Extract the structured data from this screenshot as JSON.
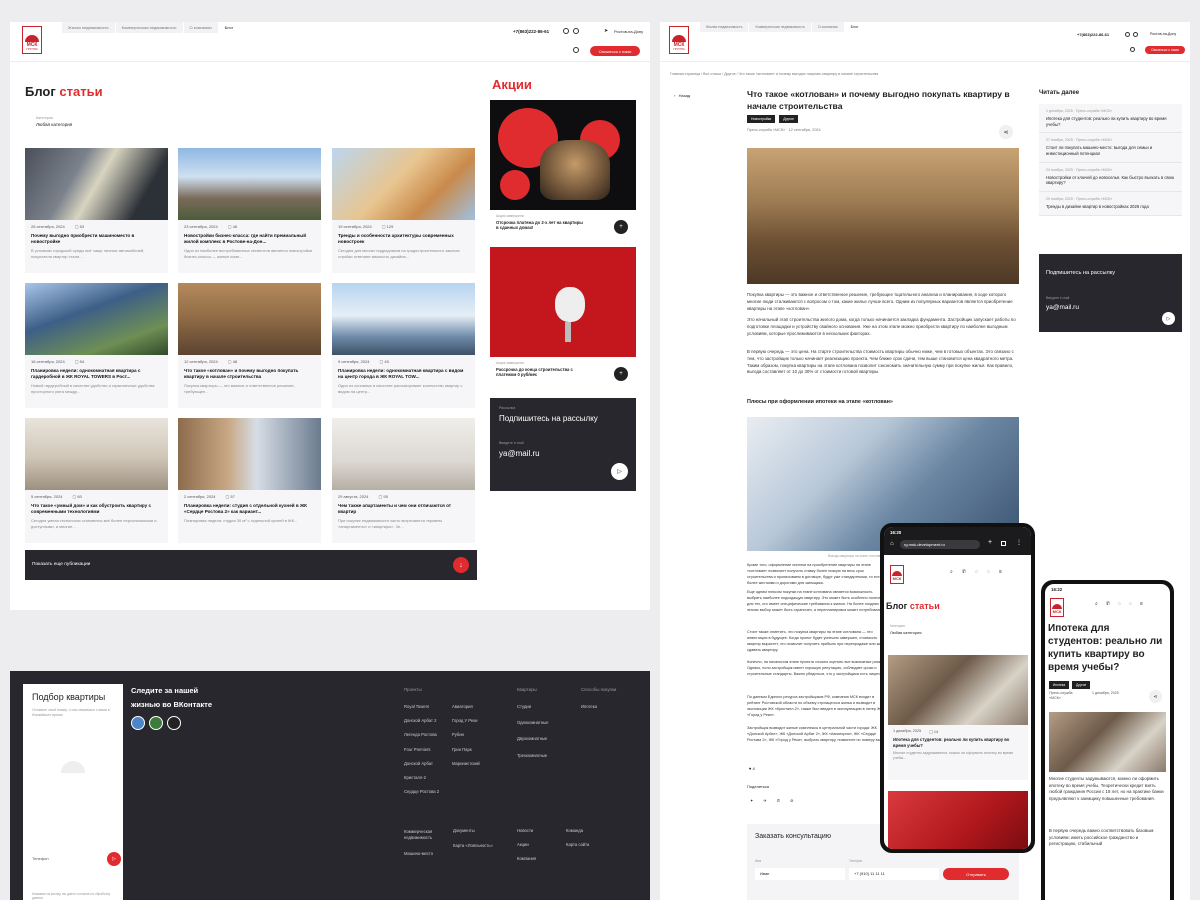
{
  "colors": {
    "accent": "#e02b2f",
    "dark": "#27272d",
    "bg": "#ededf0"
  },
  "logo": {
    "text": "МСК",
    "sub": "ГРУППА"
  },
  "header1": {
    "tabs": [
      "Жилая недвижимость",
      "Коммерческая недвижимость",
      "О компании",
      "Блог"
    ],
    "phone": "+7(863)222-86-61",
    "city": "Ростов-на-Дону",
    "cta": "Связаться с нами"
  },
  "blog": {
    "title_black": "Блог",
    "title_red": "статьи",
    "category_label": "Категория",
    "category_value": "Любая категория",
    "show_more": "Показать еще публикации",
    "cards": [
      {
        "date": "26 сентября, 2024",
        "count": "53",
        "title": "Почему выгодно приобрести машиноместо в новостройке",
        "desc": "В условиях городской среды всё чаще личные автомобилей, покупатели квартир стали..."
      },
      {
        "date": "23 сентября, 2024",
        "count": "46",
        "title": "Новостройки бизнес-класса: где найти премиальный жилой комплекс в Ростове-на-Дон...",
        "desc": "Один из наиболее востребованных сегментов является новостройки бизнес-класса — жилые комп..."
      },
      {
        "date": "19 сентября, 2024",
        "count": "129",
        "title": "Тренды и особенности архитектуры современных новостроек",
        "desc": "Сегодня для многих подрядчиков на градостроительного законах стройки отвечают важность дизайна..."
      },
      {
        "date": "16 сентября, 2024",
        "count": "54",
        "title": "Планировка недели: однокомнатная квартира с гардеробной в ЖК ROYAL TOWERS в Рост...",
        "desc": "Новый гардеробный в качестве удобство и гармоничные удобства просторного уюта между..."
      },
      {
        "date": "12 сентября, 2024",
        "count": "48",
        "title": "Что такое «котлован» и почему выгодно покупать квартиру в начале строительства",
        "desc": "Покупка квартиры — это важное и ответственное решение, требующее..."
      },
      {
        "date": "9 сентября, 2024",
        "count": "45",
        "title": "Планировка недели: однокомнатная квартира с видом на центр города в ЖК ROYAL TOW...",
        "desc": "Один из основных в качестве рассматривает количество квартир с видом на центр..."
      },
      {
        "date": "5 сентября, 2024",
        "count": "60",
        "title": "Что такое «умный дом» и как обустроить квартиру с современными технологиями",
        "desc": "Сегодня умная технология становится всё более персональными и доступными, и многие..."
      },
      {
        "date": "2 сентября, 2024",
        "count": "57",
        "title": "Планировка недели: студия с отдельной кухней в ЖК «Сердце Ростова 2» как вариант...",
        "desc": "Планировка недели: студия 30 м² с отдельной кухней в ЖК..."
      },
      {
        "date": "29 августа, 2024",
        "count": "95",
        "title": "Чем также апартаменты и чем они отличаются от квартир",
        "desc": "При покупке недвижимости часто встречаются термины «апартаменты» и «квартиры». Зн..."
      }
    ]
  },
  "promo": {
    "title": "Акции",
    "items": [
      {
        "label": "Акция завершена",
        "text": "Отсрочка платежа до 2-х лет на квартиры в сданных домах!"
      },
      {
        "label": "Акция завершена",
        "text": "Рассрочка до конца строительства с платежом 0 руб/мес"
      }
    ],
    "subscribe_label": "Рассылка",
    "subscribe_title": "Подпишитесь на рассылку",
    "email_label": "Введите e-mail",
    "email_value": "ya@mail.ru"
  },
  "footer": {
    "form_title": "Подбор квартиры",
    "form_desc": "Оставьте свой номер, и мы свяжемся с вами в ближайшее время",
    "phone_label": "Телефон",
    "vk_text": "Следите за нашей жизнью во ВКонтакте",
    "col1_head": "Проекты",
    "col1a": [
      "Royal Towers",
      "Донской Арбат 2",
      "Легенда Ростова",
      "Four Premiers",
      "Донской Арбат",
      "Кристалл-2",
      "Сердце Ростова 2"
    ],
    "col1b": [
      "Авиатория",
      "Город У Реки",
      "Рубин",
      "Грин Парк",
      "Маринистский"
    ],
    "col2_head": "Квартиры",
    "col2": [
      "Студии",
      "Однокомнатные",
      "Двухкомнатные",
      "Трехкомнатные"
    ],
    "col3_head": "Способы покупки",
    "col3": [
      "Ипотека"
    ],
    "bottom1": [
      "Коммерческая недвижимость",
      "Машино-место"
    ],
    "bottom2": [
      "Документы",
      "Карта «Лояльность»"
    ],
    "bottom3": [
      "Новости",
      "Акции",
      "Компания"
    ],
    "bottom4": [
      "Команда",
      "Карта сайта"
    ],
    "consent": "Нажимая на кнопку, вы даете согласие на обработку данных"
  },
  "article": {
    "breadcrumb": "Главная страница / Все статьи / Другое / Что такое «котлован» и почему выгодно покупать квартиру в начале строительства",
    "back": "Назад",
    "title": "Что такое «котлован» и почему выгодно покупать квартиру в начале строительства",
    "tags": [
      "Новостройки",
      "Другое"
    ],
    "author_date": "Пресс-служба «МСК» · 12 сентября, 2024",
    "p1": "Покупка квартиры — это важное и ответственное решение, требующее тщательного анализа и планирования, в ходе которого многие люди сталкиваются с вопросом о том, какие жилье лучше всего. Одним из популярных вариантов является приобретение квартиры на этапе «котлован».",
    "p2": "Это начальный этап строительства жилого дома, когда только начинается закладка фундамента. Застройщик запускает работы по подготовке площадки и устройству свайного основания. Уже на этом этапе можно приобрести квартиру по наиболее выгодным условиям, которые прослеживаются в нескольких факторах.",
    "p3": "В первую очередь — это цена. На старте строительства стоимость квартиры обычно ниже, чем в готовых объектах. Это связано с тем, что застройщик только начинает реализацию проекта. Чем ближе срок сдачи, тем выше становится цена квадратного метра. Таким образом, покупка квартиры на этапе котлована позволит сэкономить значительную сумму при покупке жилья. Как правило, выгода составляет от 10 до 30% от стоимости готовой квартиры.",
    "h2": "Плюсы при оформлении ипотеки на этапе «котлован»",
    "caption": "Выгоды квартиры на этапе «котлован»",
    "p4": "Кроме того, оформление ипотеки на приобретение квартиры на этапе «котлован» позволяет получить ставку более низкую на весь срок строительства и прописываем в договоре, будут уже стандартными, то есть более жесткими и дорогими для заемщика.",
    "p5": "Еще одним плюсом покупки на этапе котлована является возможность выбрать наиболее подходящую квартиру. Это может быть особенно полезно для тех, кто имеет специфические требования к жилью. На более поздних этапах выбор может быть ограничен, а перепланировка может потребоваться.",
    "p6": "Стоит также отметить, что покупка квартиры на этапе котлована — это инвестиция в будущее. Когда проект будет успешно завершен, стоимость квартир вырастет, что позволит получить прибыль при перепродаже или же сдавать квартиру.",
    "p7": "Конечно, на начальном этапе проекта сложно оценить все возможные риски. Однако, если застройщик имеет хорошую репутацию, соблюдает сроки и строительные стандарты. Важно убедиться, что у застройщика есть лицензия.",
    "p8": "По данным Единого ресурса застройщиков РФ, компания МСК входит в рейтинг Ростовской области по объему строящегося жилья и возводит в экспозиции ЖК «Кристалл-2», также был введен в эксплуатацию в литер ЖК «Город у Реки».",
    "p9": "Застройщик возводит жилые комплексы в центральной части города: ЖК «Донской Арбат», ЖК «Донской Арбат 2», ЖК «Авиатория», ЖК «Сердце Ростова 2», ЖК «Город у Реки», выбрать квартиру, позвоните по номеру выше.",
    "likes": "4",
    "share_label": "Поделиться",
    "consult_title": "Заказать консультацию",
    "name_label": "Имя",
    "name_value": "Иван",
    "tel_label": "Телефон",
    "tel_value": "+7 (910) 11 11 11",
    "send": "Отправить"
  },
  "read_more": {
    "title": "Читать далее",
    "items": [
      {
        "date": "1 декабря, 2025 · Пресс-служба «МСК»",
        "title": "Ипотека для студентов: реально ли купить квартиру во время учебы?"
      },
      {
        "date": "27 ноября, 2025 · Пресс-служба «МСК»",
        "title": "Стоит ли покупать машино-место: выгода для семьи и инвестиционный потенциал"
      },
      {
        "date": "24 ноября, 2025 · Пресс-служба «МСК»",
        "title": "Новостройки от ключей до новоселья. Как быстро въехать в свою квартиру?"
      },
      {
        "date": "20 ноября, 2025 · Пресс-служба «МСК»",
        "title": "Тренды в дизайне квартир в новостройках 2026 года"
      }
    ],
    "subscribe_title": "Подпишитесь на рассылку",
    "email_label": "Введите e-mail",
    "email_value": "ya@mail.ru"
  },
  "header2": {
    "tabs": [
      "Жилая недвижимость",
      "Коммерческая недвижимость",
      "О компании",
      "Блог"
    ],
    "phone": "+7(863)222-86-61",
    "city": "Ростов-на-Дону",
    "cta": "Связаться с нами"
  },
  "phone1": {
    "time": "16:20",
    "url": "rg.msk-development.ru",
    "title_black": "Блог",
    "title_red": "статьи",
    "category_label": "Категория",
    "category_value": "Любая категория",
    "card_date": "1 декабря, 2025",
    "card_count": "14",
    "card_title": "Ипотека для студентов: реально ли купить квартиру во время учебы?",
    "card_desc": "Многие студенты задумываются, можно ли оформить ипотеку во время учебы..."
  },
  "phone2": {
    "time": "16:22",
    "title": "Ипотека для студентов: реально ли купить квартиру во время учебы?",
    "tags": [
      "Ипотека",
      "Другое"
    ],
    "author": "Пресс-служба «МСК»",
    "date": "1 декабря, 2025",
    "p1": "Многие студенты задумываются, можно ли оформить ипотеку во время учебы. Теоретически кредит взять любой гражданин России с 18 лет, но на практике банки предъявляют к заемщику повышенные требования.",
    "p2": "В первую очередь важно соответствовать базовым условиям: иметь российское гражданство и регистрацию, стабильный"
  }
}
